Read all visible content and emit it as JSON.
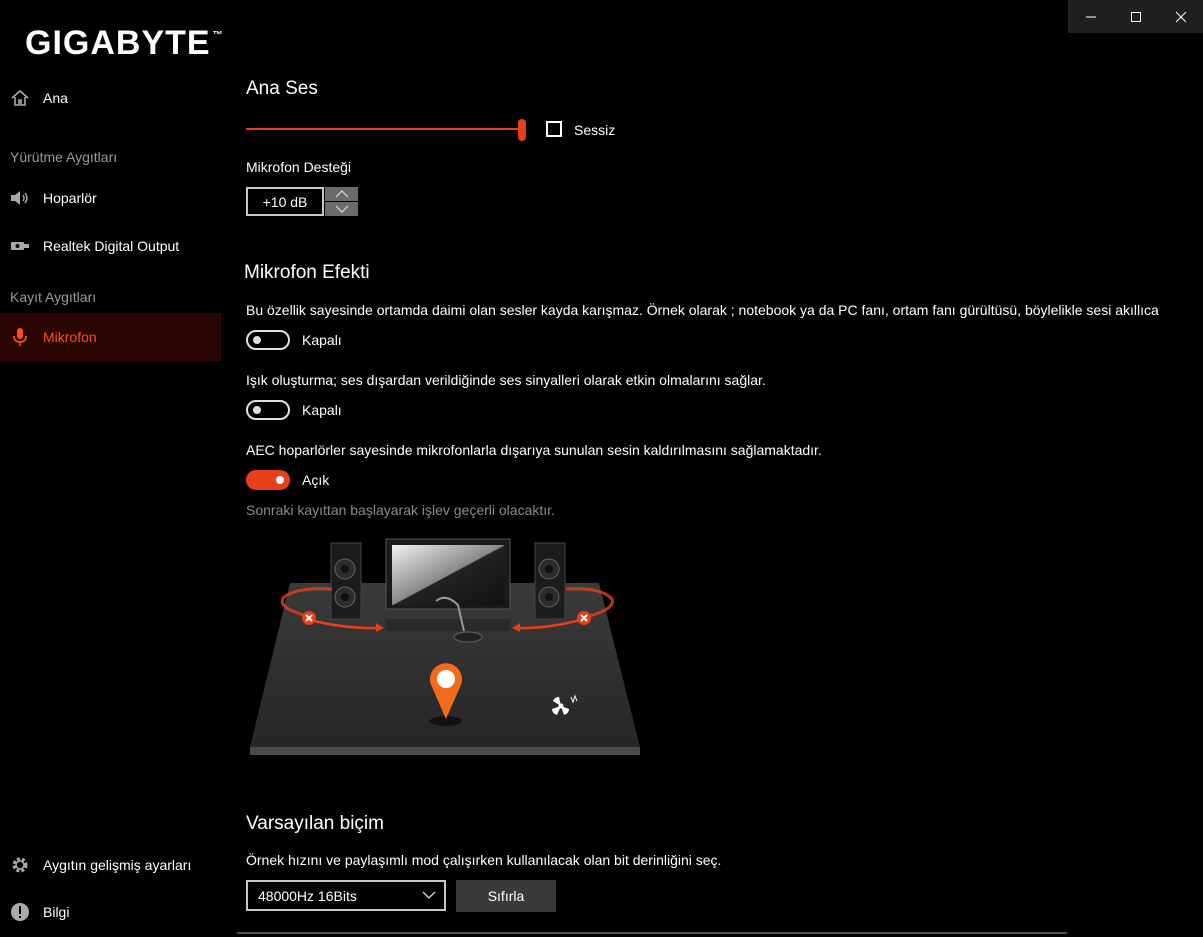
{
  "window": {
    "minimize_icon": "minimize-icon",
    "maximize_icon": "maximize-icon",
    "close_icon": "close-icon"
  },
  "brand": {
    "logo_text": "GIGABYTE",
    "logo_mark": "™"
  },
  "sidebar": {
    "home": {
      "label": "Ana",
      "icon": "home-icon"
    },
    "playback_section": "Yürütme Aygıtları",
    "playback_items": [
      {
        "label": "Hoparlör",
        "icon": "speaker-icon"
      },
      {
        "label": "Realtek Digital Output",
        "icon": "digital-output-icon"
      }
    ],
    "recording_section": "Kayıt Aygıtları",
    "recording_items": [
      {
        "label": "Mikrofon",
        "icon": "microphone-icon",
        "active": true
      }
    ],
    "advanced": {
      "label": "Aygıtın gelişmiş ayarları",
      "icon": "gear-icon"
    },
    "info": {
      "label": "Bilgi",
      "icon": "info-icon"
    }
  },
  "main": {
    "master": {
      "title": "Ana Ses",
      "volume_level": 1.0,
      "mute_label": "Sessiz",
      "mute_checked": false
    },
    "boost": {
      "title": "Mikrofon Desteği",
      "value": "+10 dB"
    },
    "effects": {
      "title": "Mikrofon Efekti",
      "items": [
        {
          "description": "Bu özellik sayesinde ortamda daimi olan sesler kayda karışmaz. Örnek olarak ; notebook ya da PC fanı, ortam fanı gürültüsü, böylelikle sesi akıllıca",
          "state_label": "Kapalı",
          "on": false
        },
        {
          "description": "Işık oluşturma; ses dışardan verildiğinde ses sinyalleri olarak etkin olmalarını sağlar.",
          "state_label": "Kapalı",
          "on": false
        },
        {
          "description": "AEC hoparlörler sayesinde mikrofonlarla dışarıya sunulan sesin kaldırılmasını sağlamaktadır.",
          "state_label": "Açık",
          "on": true
        }
      ],
      "note": "Sonraki kayıttan başlayarak işlev geçerli olacaktır."
    },
    "format": {
      "title": "Varsayılan biçim",
      "description": "Örnek hızını ve paylaşımlı mod çalışırken kullanılacak olan bit derinliğini seç.",
      "selected": "48000Hz 16Bits",
      "reset_label": "Sıfırla"
    }
  },
  "colors": {
    "accent": "#e83f1a",
    "active_bg": "#2a0703",
    "muted_text": "#8a8a8a"
  }
}
